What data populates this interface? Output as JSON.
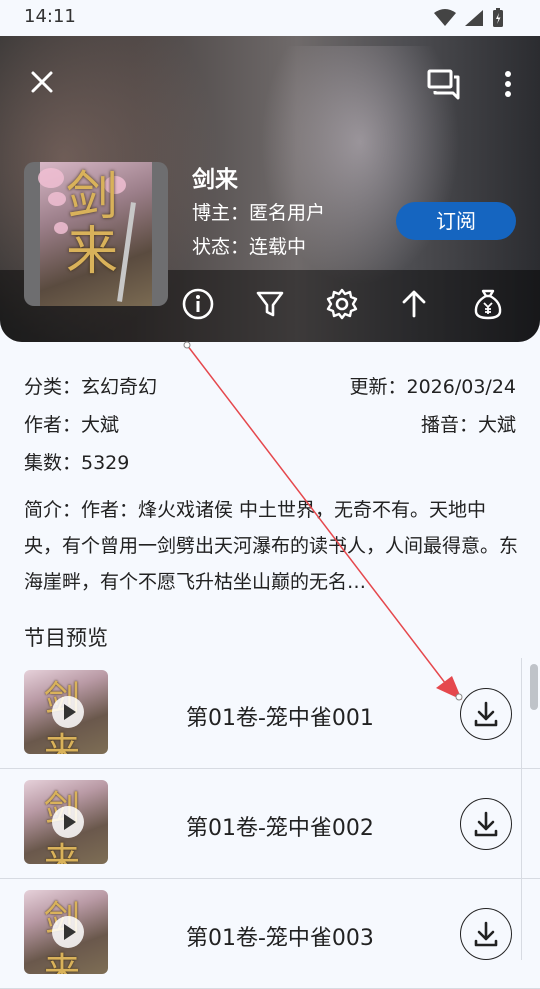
{
  "status_bar": {
    "time": "14:11"
  },
  "header": {
    "title": "剑来",
    "blogger": "博主：匿名用户",
    "status": "状态：连载中",
    "subscribe_label": "订阅",
    "cover_glyph": "剑来",
    "toolbar_icons": [
      "info-icon",
      "filter-icon",
      "settings-icon",
      "arrow-up-icon",
      "money-bag-icon"
    ]
  },
  "info": {
    "category": "分类：玄幻奇幻",
    "updated": "更新：2026/03/24",
    "author": "作者：大斌",
    "narrator": "播音：大斌",
    "episodes": "集数：5329",
    "description": "简介：作者：烽火戏诸侯 中土世界，无奇不有。天地中央，有个曾用一剑劈出天河瀑布的读书人，人间最得意。东海崖畔，有个不愿飞升枯坐山巅的无名…"
  },
  "section_title": "节目预览",
  "episodes": [
    {
      "title": "第01卷-笼中雀001"
    },
    {
      "title": "第01卷-笼中雀002"
    },
    {
      "title": "第01卷-笼中雀003"
    }
  ],
  "colors": {
    "accent": "#1565c0",
    "annotation": "#e5484d",
    "background": "#f6f9fe"
  }
}
